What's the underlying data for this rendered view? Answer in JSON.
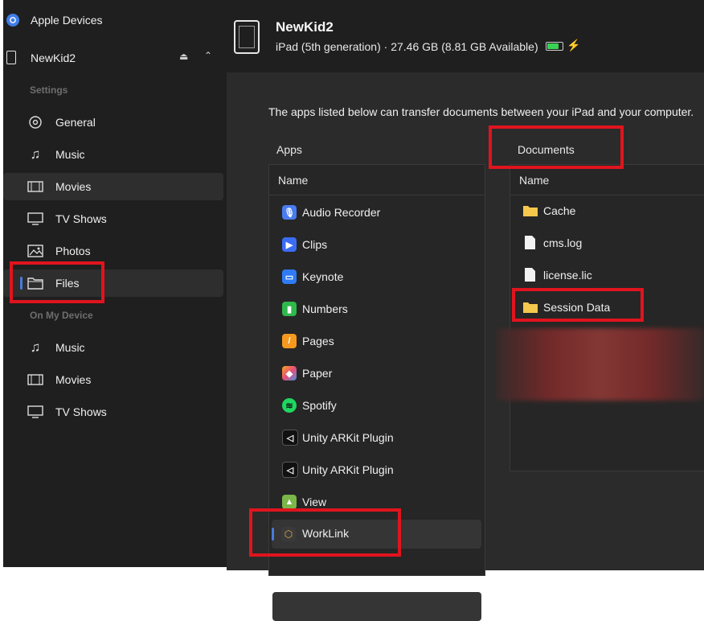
{
  "sidebar": {
    "app_title": "Apple Devices",
    "device_name": "NewKid2",
    "section_settings": "Settings",
    "settings_items": [
      {
        "label": "General",
        "icon": "gear-icon"
      },
      {
        "label": "Music",
        "icon": "music-note-icon"
      },
      {
        "label": "Movies",
        "icon": "film-icon"
      },
      {
        "label": "TV Shows",
        "icon": "tv-icon"
      },
      {
        "label": "Photos",
        "icon": "photo-icon"
      },
      {
        "label": "Files",
        "icon": "folder-icon"
      }
    ],
    "section_device": "On My Device",
    "device_items": [
      {
        "label": "Music",
        "icon": "music-note-icon"
      },
      {
        "label": "Movies",
        "icon": "film-icon"
      },
      {
        "label": "TV Shows",
        "icon": "tv-icon"
      }
    ]
  },
  "header": {
    "device_name": "NewKid2",
    "device_info": "iPad (5th generation) · 27.46 GB (8.81 GB Available)"
  },
  "main": {
    "intro": "The apps listed below can transfer documents between your iPad and your computer.",
    "apps_heading": "Apps",
    "documents_heading": "Documents",
    "name_col": "Name",
    "apps": [
      {
        "label": "Audio Recorder",
        "color": "#4a7cf0",
        "glyph": "🎙"
      },
      {
        "label": "Clips",
        "color": "#3b6cf5",
        "glyph": "▶"
      },
      {
        "label": "Keynote",
        "color": "#2f7bf5",
        "glyph": "▭"
      },
      {
        "label": "Numbers",
        "color": "#2fb84b",
        "glyph": "▮"
      },
      {
        "label": "Pages",
        "color": "#f59a1f",
        "glyph": "/"
      },
      {
        "label": "Paper",
        "color": "#f3f3f3",
        "glyph": "◆"
      },
      {
        "label": "Spotify",
        "color": "#1ed760",
        "glyph": "≋"
      },
      {
        "label": "Unity ARKit Plugin",
        "color": "#1a1a1a",
        "glyph": "◁"
      },
      {
        "label": "Unity ARKit Plugin",
        "color": "#1a1a1a",
        "glyph": "◁"
      },
      {
        "label": "View",
        "color": "#7ab648",
        "glyph": "▲"
      },
      {
        "label": "WorkLink",
        "color": "#3a3a3a",
        "glyph": "⬡"
      }
    ],
    "documents": [
      {
        "label": "Cache",
        "type": "folder"
      },
      {
        "label": "cms.log",
        "type": "file"
      },
      {
        "label": "license.lic",
        "type": "file"
      },
      {
        "label": "Session Data",
        "type": "folder"
      }
    ]
  },
  "colors": {
    "accent": "#4a7bd9",
    "highlight_box": "#e0141e",
    "battery": "#39d353",
    "folder": "#f5c84c"
  }
}
